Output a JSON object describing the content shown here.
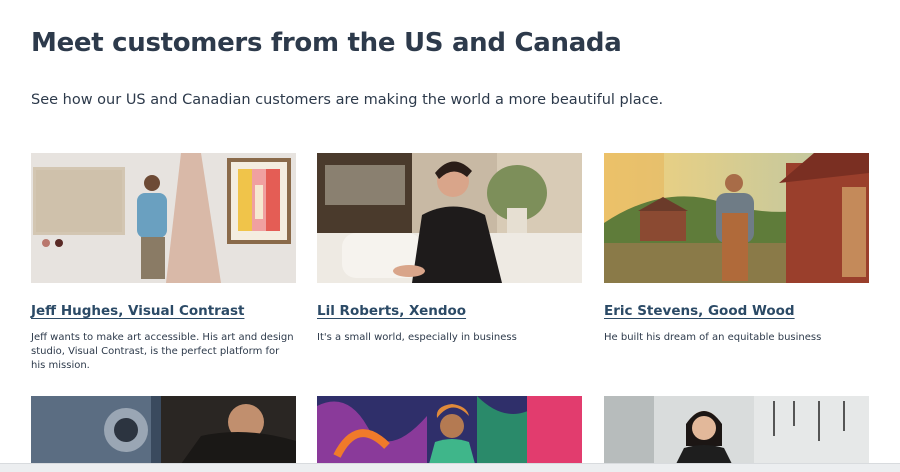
{
  "section": {
    "title": "Meet customers from the US and Canada",
    "subtitle": "See how our US and Canadian customers are making the world a more beautiful place."
  },
  "cards": [
    {
      "name": "Jeff Hughes, Visual Contrast",
      "description": "Jeff wants to make art accessible. His art and design studio, Visual Contrast, is the perfect platform for his mission."
    },
    {
      "name": "Lil Roberts, Xendoo",
      "description": "It's a small world, especially in business"
    },
    {
      "name": "Eric Stevens, Good Wood",
      "description": "He built his dream of an equitable business"
    }
  ]
}
